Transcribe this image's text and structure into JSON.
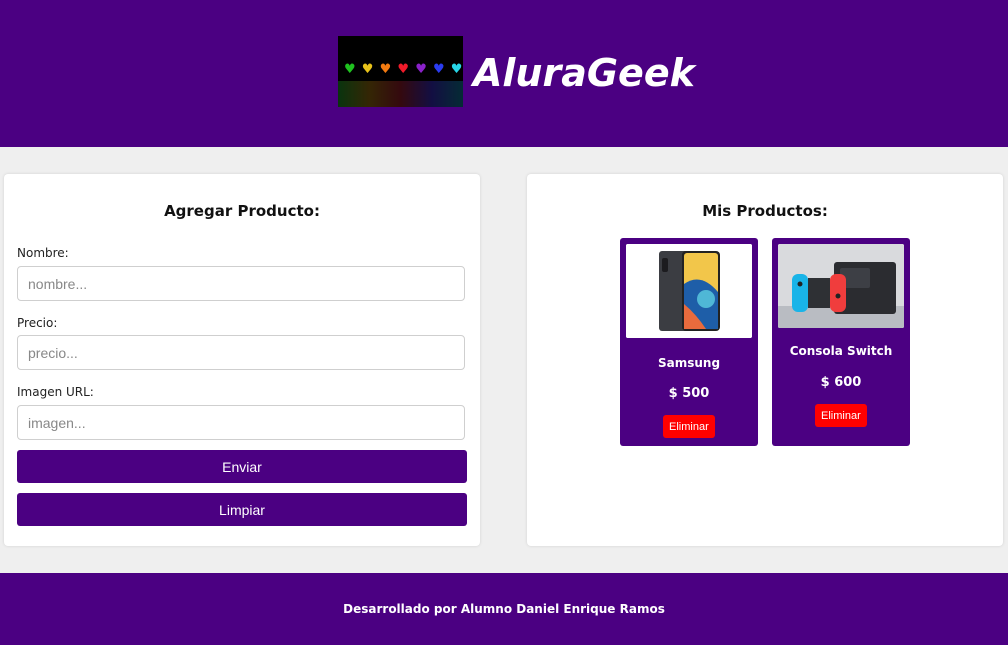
{
  "header": {
    "brand": "AluraGeek",
    "logo_hearts": [
      "♥",
      "♥",
      "♥",
      "♥",
      "♥",
      "♥",
      "♥"
    ],
    "logo_heart_colors": [
      "#1fc21f",
      "#e8c21a",
      "#f27a10",
      "#f01b2a",
      "#8a21c9",
      "#2a3cf0",
      "#27d6e8"
    ]
  },
  "form": {
    "title": "Agregar Producto:",
    "name_label": "Nombre:",
    "name_placeholder": "nombre...",
    "price_label": "Precio:",
    "price_placeholder": "precio...",
    "image_label": "Imagen URL:",
    "image_placeholder": "imagen...",
    "submit_label": "Enviar",
    "clear_label": "Limpiar"
  },
  "products": {
    "title": "Mis Productos:",
    "items": [
      {
        "name": "Samsung",
        "price": "$ 500",
        "delete_label": "Eliminar"
      },
      {
        "name": "Consola Switch",
        "price": "$ 600",
        "delete_label": "Eliminar"
      }
    ]
  },
  "footer": {
    "text": "Desarrollado por Alumno Daniel Enrique Ramos"
  },
  "colors": {
    "brand": "#4b0082",
    "danger": "#ff0000",
    "background": "#efefef"
  }
}
